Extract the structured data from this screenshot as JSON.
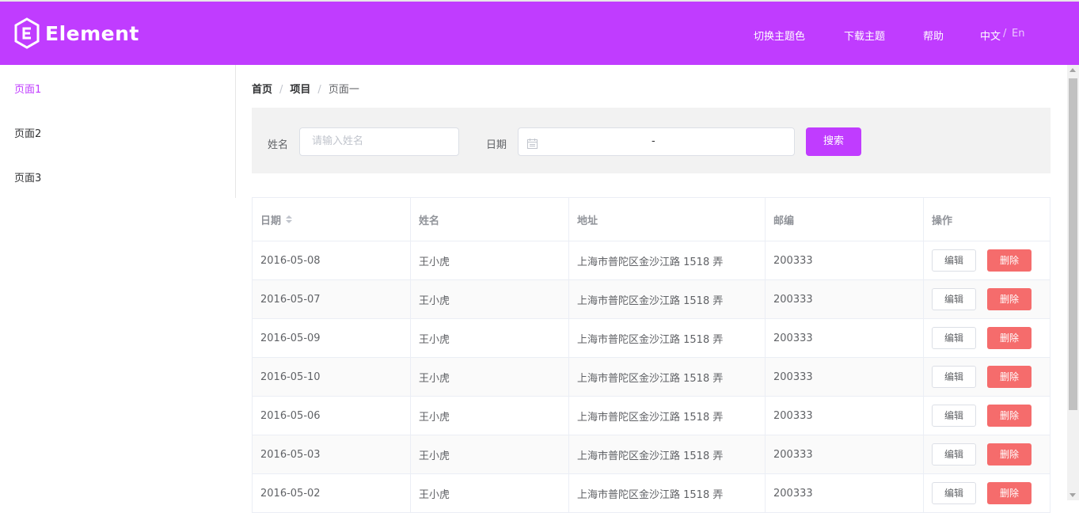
{
  "header": {
    "logo_text": "Element",
    "nav": {
      "switch_theme": "切换主题色",
      "download_theme": "下载主题",
      "help": "帮助",
      "lang_cn": "中文",
      "lang_sep": "/",
      "lang_en": "En"
    },
    "colors": {
      "primary": "#c03cff",
      "danger": "#f56c6c"
    }
  },
  "sidebar": {
    "items": [
      {
        "label": "页面1",
        "active": true
      },
      {
        "label": "页面2",
        "active": false
      },
      {
        "label": "页面3",
        "active": false
      }
    ]
  },
  "breadcrumb": {
    "home": "首页",
    "project": "项目",
    "current": "页面一",
    "sep": "/"
  },
  "filter": {
    "name_label": "姓名",
    "name_placeholder": "请输入姓名",
    "date_label": "日期",
    "date_range_sep": "-",
    "search_label": "搜索"
  },
  "table": {
    "columns": [
      "日期",
      "姓名",
      "地址",
      "邮编",
      "操作"
    ],
    "edit_label": "编辑",
    "delete_label": "删除",
    "rows": [
      {
        "date": "2016-05-08",
        "name": "王小虎",
        "address": "上海市普陀区金沙江路 1518 弄",
        "zip": "200333"
      },
      {
        "date": "2016-05-07",
        "name": "王小虎",
        "address": "上海市普陀区金沙江路 1518 弄",
        "zip": "200333"
      },
      {
        "date": "2016-05-09",
        "name": "王小虎",
        "address": "上海市普陀区金沙江路 1518 弄",
        "zip": "200333"
      },
      {
        "date": "2016-05-10",
        "name": "王小虎",
        "address": "上海市普陀区金沙江路 1518 弄",
        "zip": "200333"
      },
      {
        "date": "2016-05-06",
        "name": "王小虎",
        "address": "上海市普陀区金沙江路 1518 弄",
        "zip": "200333"
      },
      {
        "date": "2016-05-03",
        "name": "王小虎",
        "address": "上海市普陀区金沙江路 1518 弄",
        "zip": "200333"
      },
      {
        "date": "2016-05-02",
        "name": "王小虎",
        "address": "上海市普陀区金沙江路 1518 弄",
        "zip": "200333"
      }
    ]
  }
}
